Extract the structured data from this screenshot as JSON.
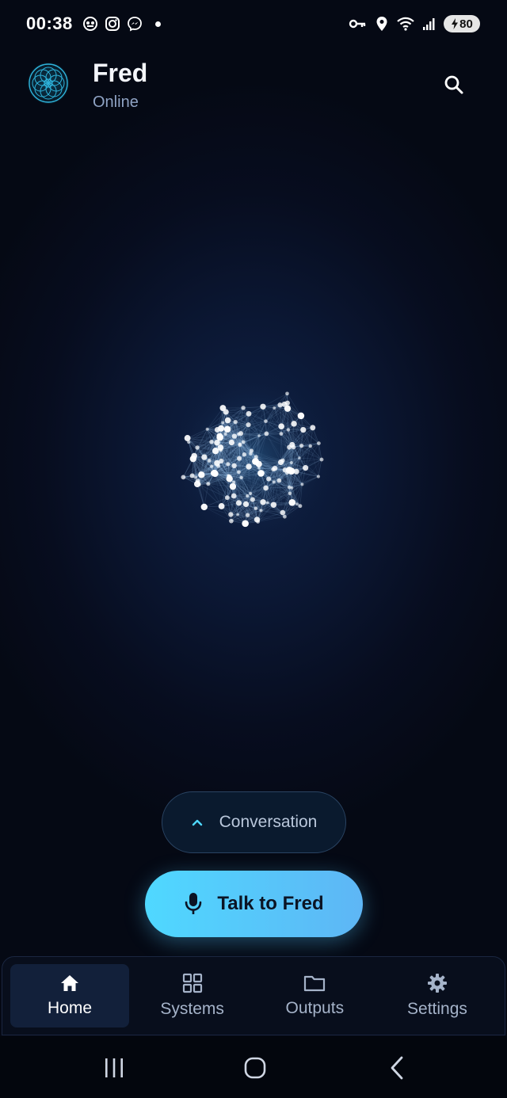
{
  "status_bar": {
    "time": "00:38",
    "battery": "80",
    "left_icons": [
      "notification-app-icon",
      "instagram-icon",
      "messenger-icon",
      "more-notifications-dot"
    ],
    "right_icons": [
      "vpn-key-icon",
      "location-icon",
      "wifi-icon",
      "signal-icon",
      "battery-icon"
    ]
  },
  "header": {
    "name": "Fred",
    "status": "Online",
    "avatar_icon": "mandala-avatar-icon",
    "search_icon": "search-icon"
  },
  "main": {
    "orb_icon": "neural-network-orb"
  },
  "conversation": {
    "label": "Conversation",
    "icon": "chevron-up-icon"
  },
  "talk": {
    "label": "Talk to Fred",
    "icon": "microphone-icon"
  },
  "nav": {
    "items": [
      {
        "label": "Home",
        "icon": "home-icon",
        "active": true
      },
      {
        "label": "Systems",
        "icon": "grid-icon",
        "active": false
      },
      {
        "label": "Outputs",
        "icon": "folder-icon",
        "active": false
      },
      {
        "label": "Settings",
        "icon": "gear-icon",
        "active": false
      }
    ]
  },
  "system_nav": [
    "recent-apps-button",
    "home-button",
    "back-button"
  ],
  "colors": {
    "background": "#050914",
    "accent": "#4fd8ff",
    "talk_button_end": "#5eb6f5",
    "muted_text": "#8fa3c4",
    "nav_active_bg": "#12203a"
  }
}
